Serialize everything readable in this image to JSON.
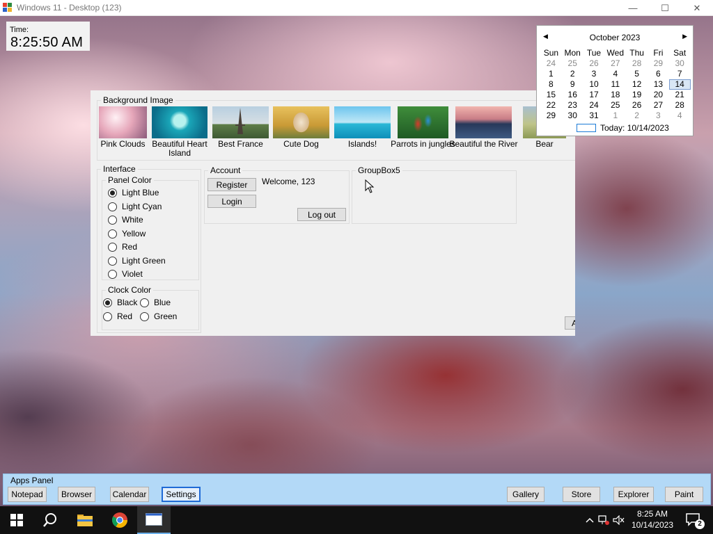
{
  "window": {
    "title": "Windows 11 - Desktop (123)",
    "controls": {
      "minimize": "—",
      "maximize": "☐",
      "close": "✕"
    }
  },
  "clock": {
    "label": "Time:",
    "value": "8:25:50 AM"
  },
  "calendar": {
    "month": "October 2023",
    "prev": "◀",
    "next": "▶",
    "weekdays": [
      "Sun",
      "Mon",
      "Tue",
      "Wed",
      "Thu",
      "Fri",
      "Sat"
    ],
    "weeks": [
      [
        "24",
        "25",
        "26",
        "27",
        "28",
        "29",
        "30"
      ],
      [
        "1",
        "2",
        "3",
        "4",
        "5",
        "6",
        "7"
      ],
      [
        "8",
        "9",
        "10",
        "11",
        "12",
        "13",
        "14"
      ],
      [
        "15",
        "16",
        "17",
        "18",
        "19",
        "20",
        "21"
      ],
      [
        "22",
        "23",
        "24",
        "25",
        "26",
        "27",
        "28"
      ],
      [
        "29",
        "30",
        "31",
        "1",
        "2",
        "3",
        "4"
      ]
    ],
    "selected": "14",
    "today_label": "Today: 10/14/2023"
  },
  "form": {
    "background_group": {
      "title": "Background Image",
      "images": [
        {
          "label": "Pink Clouds",
          "icon": "pink-clouds-image"
        },
        {
          "label": "Beautiful Heart Island",
          "icon": "heart-island-image"
        },
        {
          "label": "Best France",
          "icon": "eiffel-tower-image"
        },
        {
          "label": "Cute Dog",
          "icon": "dog-image"
        },
        {
          "label": "Islands!",
          "icon": "islands-image"
        },
        {
          "label": "Parrots in jungles",
          "icon": "parrots-image"
        },
        {
          "label": "Beautiful the River",
          "icon": "river-image"
        },
        {
          "label": "Bear",
          "icon": "bear-image"
        }
      ]
    },
    "interface_group": {
      "title": "Interface",
      "panel_color": {
        "title": "Panel Color",
        "options": [
          "Light Blue",
          "Light Cyan",
          "White",
          "Yellow",
          "Red",
          "Light Green",
          "Violet"
        ],
        "selected": "Light Blue"
      },
      "clock_color": {
        "title": "Clock Color",
        "options": [
          "Black",
          "Blue",
          "Red",
          "Green"
        ],
        "selected": "Black"
      }
    },
    "account_group": {
      "title": "Account",
      "register": "Register",
      "login": "Login",
      "welcome": "Welcome, 123",
      "logout": "Log out"
    },
    "group5": {
      "title": "GroupBox5"
    },
    "partial_button": "A"
  },
  "apps_panel": {
    "title": "Apps Panel",
    "left_buttons": [
      "Notepad",
      "Browser",
      "Calendar",
      "Settings"
    ],
    "right_buttons": [
      "Gallery",
      "Store",
      "Explorer",
      "Paint"
    ],
    "focused": "Settings"
  },
  "taskbar": {
    "icons": [
      "windows-start-icon",
      "search-icon",
      "file-explorer-icon",
      "chrome-icon",
      "app-window-icon"
    ],
    "time": "8:25 AM",
    "date": "10/14/2023",
    "notification_count": "2"
  }
}
